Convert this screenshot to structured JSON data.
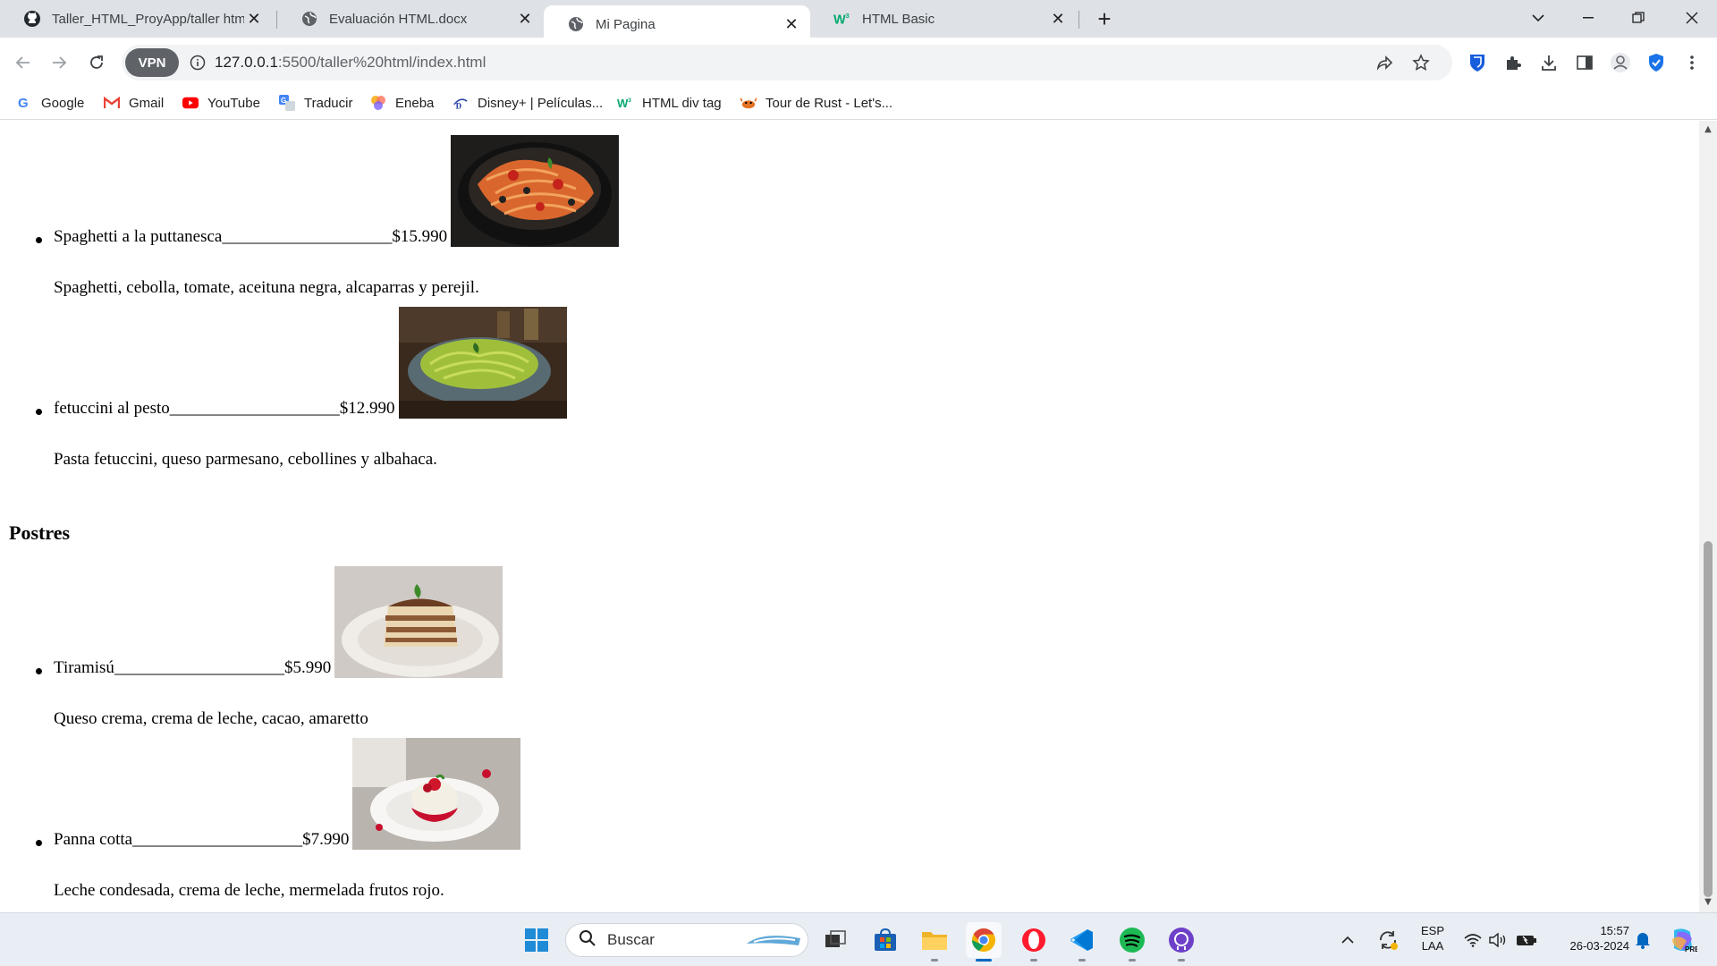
{
  "browser": {
    "tabs": [
      {
        "title": "Taller_HTML_ProyApp/taller htm",
        "favicon": "github-icon",
        "active": false
      },
      {
        "title": "Evaluación HTML.docx",
        "favicon": "globe-icon",
        "active": false
      },
      {
        "title": "Mi Pagina",
        "favicon": "globe-icon",
        "active": true
      },
      {
        "title": "HTML Basic",
        "favicon": "w3schools-icon",
        "active": false
      }
    ],
    "vpn_label": "VPN",
    "url_host": "127.0.0.1",
    "url_rest": ":5500/taller%20html/index.html",
    "bookmarks": [
      {
        "label": "Google",
        "icon": "google-icon"
      },
      {
        "label": "Gmail",
        "icon": "gmail-icon"
      },
      {
        "label": "YouTube",
        "icon": "youtube-icon"
      },
      {
        "label": "Traducir",
        "icon": "translate-icon"
      },
      {
        "label": "Eneba",
        "icon": "eneba-icon"
      },
      {
        "label": "Disney+ | Películas...",
        "icon": "disney-icon"
      },
      {
        "label": "HTML div tag",
        "icon": "w3schools-icon"
      },
      {
        "label": "Tour de Rust - Let's...",
        "icon": "rust-icon"
      }
    ]
  },
  "page": {
    "pastas": [
      {
        "name": "Spaghetti a la puttanesca",
        "dots": "____________________",
        "price": "$15.990",
        "desc": "Spaghetti, cebolla, tomate, aceituna negra, alcaparras y perejil."
      },
      {
        "name": "fetuccini al pesto",
        "dots": "____________________",
        "price": "$12.990",
        "desc": "Pasta fetuccini, queso parmesano, cebollines y albahaca."
      }
    ],
    "desserts_heading": "Postres",
    "desserts": [
      {
        "name": "Tiramisú",
        "dots": "____________________",
        "price": "$5.990",
        "desc": "Queso crema, crema de leche, cacao, amaretto"
      },
      {
        "name": "Panna cotta",
        "dots": "____________________",
        "price": "$7.990",
        "desc": "Leche condesada, crema de leche, mermelada frutos rojo."
      }
    ]
  },
  "taskbar": {
    "search_placeholder": "Buscar",
    "lang_top": "ESP",
    "lang_bottom": "LAA",
    "time": "15:57",
    "date": "26-03-2024"
  }
}
